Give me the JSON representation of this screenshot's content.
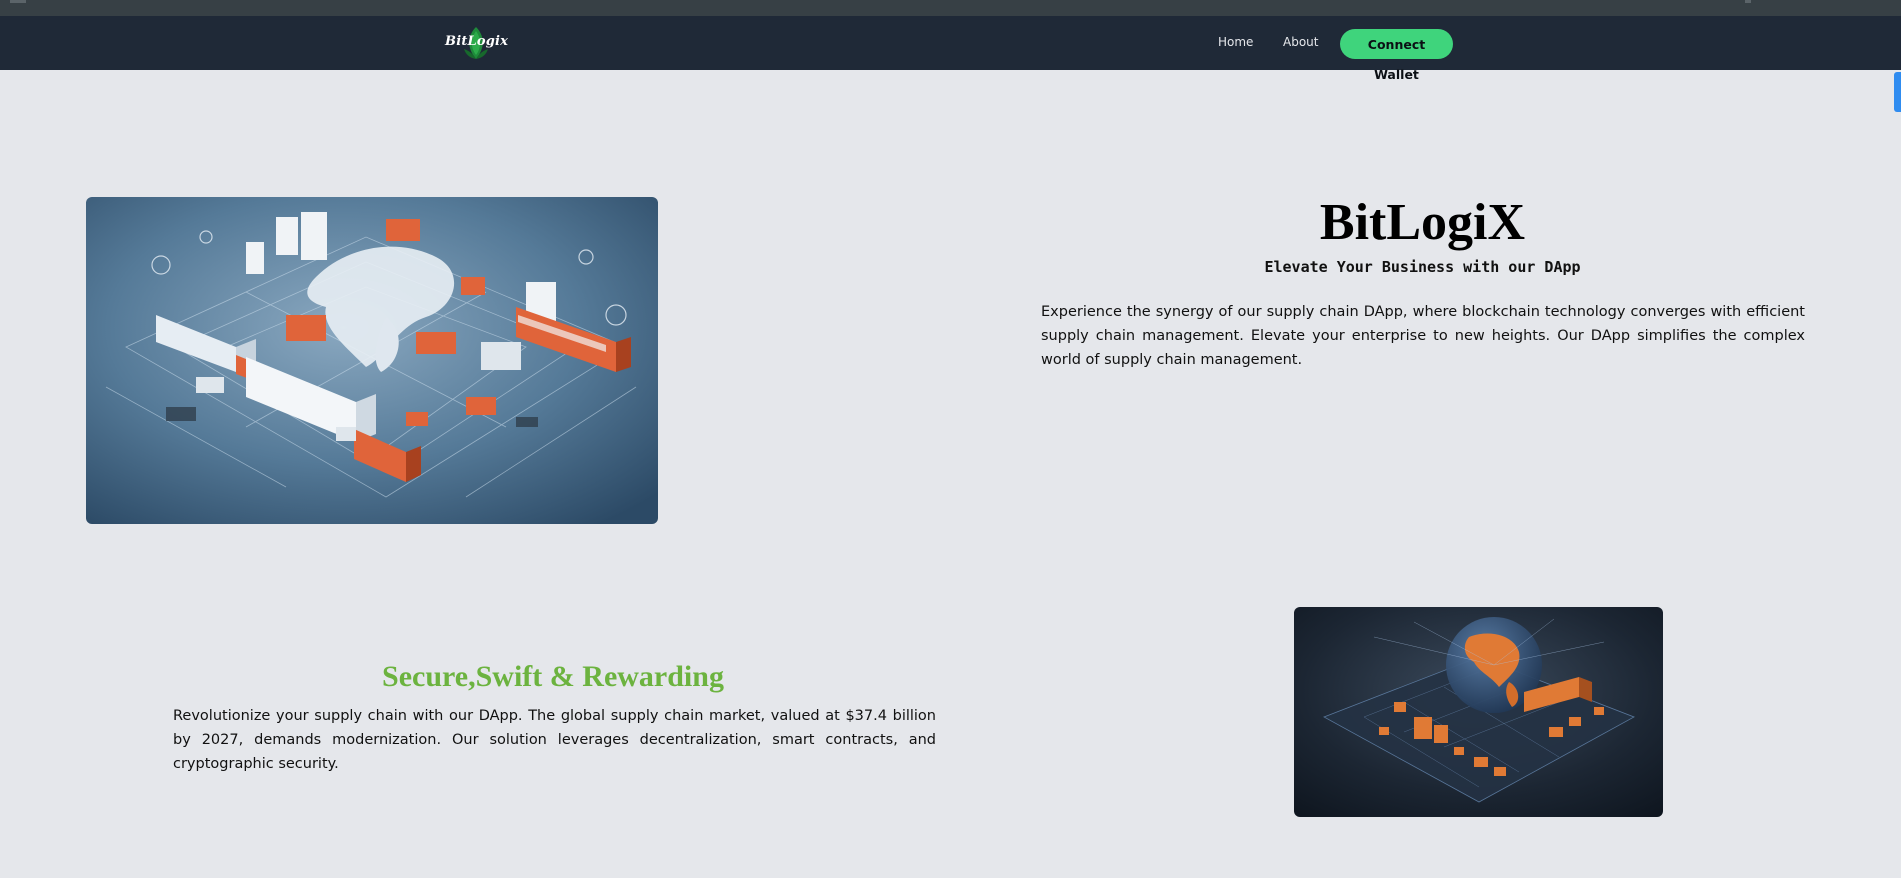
{
  "nav": {
    "logo_text": "BitLogix",
    "home_label": "Home",
    "about_label": "About",
    "connect_label": "Connect Wallet"
  },
  "hero": {
    "title": "BitLogiX",
    "subtitle": "Elevate Your Business with our DApp",
    "description": "Experience the synergy of our supply chain DApp, where blockchain technology converges with efficient supply chain management. Elevate your enterprise to new heights. Our DApp simplifies the complex world of supply chain management."
  },
  "feature": {
    "title": "Secure,Swift & Rewarding",
    "description": "Revolutionize your supply chain with our DApp. The global supply chain market, valued at $37.4 billion by 2027, demands modernization. Our solution leverages decentralization, smart contracts, and cryptographic security."
  },
  "colors": {
    "navbar_bg": "#1f2937",
    "page_bg": "#e5e7eb",
    "accent_green": "#3fd47c",
    "feature_title_green": "#6cb33f"
  }
}
